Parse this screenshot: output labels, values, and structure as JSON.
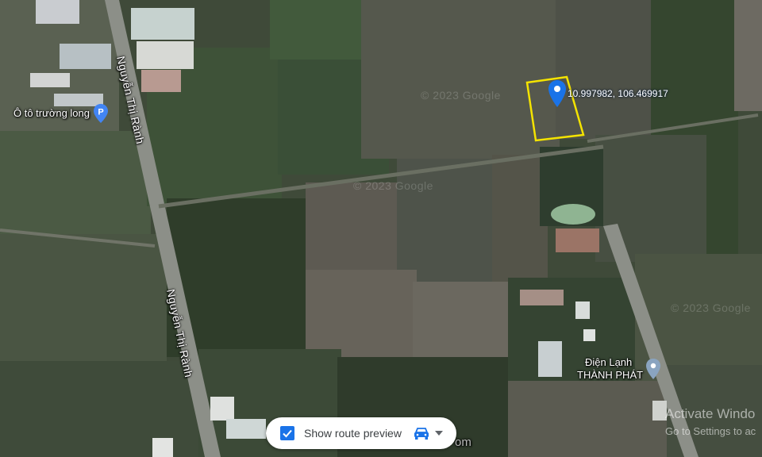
{
  "map": {
    "watermarks": [
      "© 2023 Google",
      "© 2023 Google",
      "© 2023 Google"
    ],
    "roads": [
      {
        "name": "Nguyễn Thị Rành"
      },
      {
        "name": "Nguyễn Thị Rành"
      }
    ],
    "places": [
      {
        "name": "Ô tô trường long",
        "icon": "parking-pin-icon",
        "color": "#4285f4"
      },
      {
        "name_line1": "Điện Lạnh",
        "name_line2": "THÀNH PHÁT",
        "icon": "place-pin-icon",
        "color": "#8aa4c0"
      }
    ],
    "marker": {
      "coordinates": "10.997982, 106.469917",
      "icon": "location-pin-icon",
      "color": "#1a73e8",
      "highlight_color": "#f4e300"
    }
  },
  "route_preview": {
    "label": "Show route preview",
    "checked": true,
    "mode_icon": "car-icon",
    "dropdown_icon": "caret-down-icon",
    "accent": "#1a73e8"
  },
  "os_overlay": {
    "activate_title": "Activate Windo",
    "activate_subtitle": "Go to Settings to ac"
  },
  "partial_text": "om"
}
